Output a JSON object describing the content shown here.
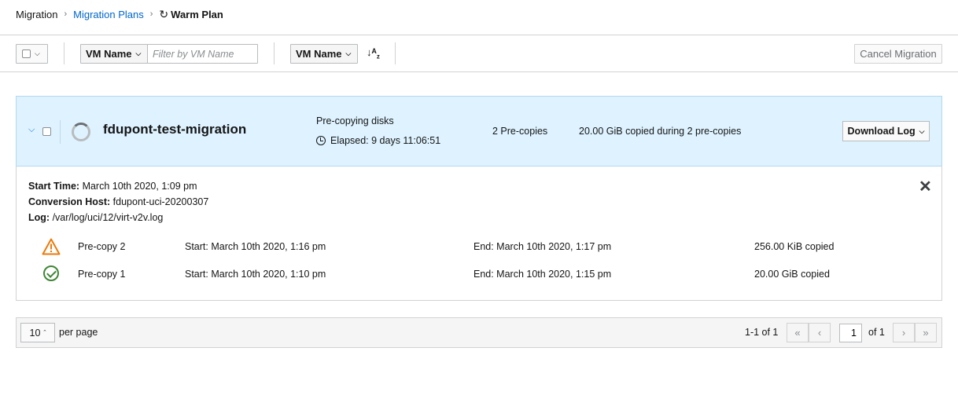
{
  "breadcrumb": {
    "items": [
      "Migration",
      "Migration Plans"
    ],
    "current": "Warm Plan"
  },
  "toolbar": {
    "filter_field": "VM Name",
    "filter_placeholder": "Filter by VM Name",
    "sort_field": "VM Name",
    "cancel_label": "Cancel Migration"
  },
  "plan": {
    "name": "fdupont-test-migration",
    "status": "Pre-copying disks",
    "elapsed": "Elapsed: 9 days 11:06:51",
    "precopies": "2 Pre-copies",
    "copied": "20.00 GiB copied during 2 pre-copies",
    "download_label": "Download Log"
  },
  "details": {
    "start_time_label": "Start Time:",
    "start_time": "March 10th 2020, 1:09 pm",
    "conversion_host_label": "Conversion Host:",
    "conversion_host": "fdupont-uci-20200307",
    "log_label": "Log:",
    "log": "/var/log/uci/12/virt-v2v.log",
    "precopies": [
      {
        "name": "Pre-copy 2",
        "start": "Start: March 10th 2020, 1:16 pm",
        "end": "End: March 10th 2020, 1:17 pm",
        "size": "256.00 KiB copied",
        "status_icon": "warning-triangle-icon",
        "status_color": "#ec7a08"
      },
      {
        "name": "Pre-copy 1",
        "start": "Start: March 10th 2020, 1:10 pm",
        "end": "End: March 10th 2020, 1:15 pm",
        "size": "20.00 GiB copied",
        "status_icon": "check-circle-icon",
        "status_color": "#3e8635"
      }
    ]
  },
  "pagination": {
    "per_page": "10",
    "per_page_label": "per page",
    "range": "1-1 of 1",
    "page": "1",
    "of_pages": "of 1"
  }
}
